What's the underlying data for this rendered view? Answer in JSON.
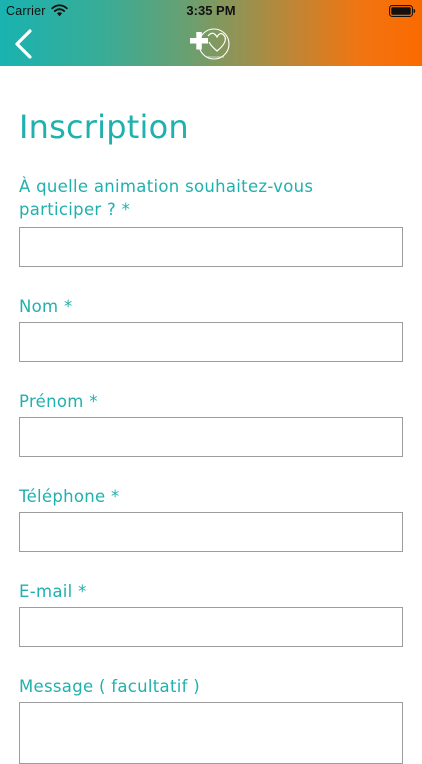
{
  "status_bar": {
    "carrier": "Carrier",
    "time": "3:35 PM"
  },
  "header": {
    "back_icon": "chevron-left-icon",
    "logo_icon": "cross-heart-logo",
    "gradient_start": "#19b3b0",
    "gradient_end": "#fb6a00"
  },
  "colors": {
    "accent": "#1fb1ae",
    "input_border": "#9d9d9d"
  },
  "form": {
    "title": "Inscription",
    "fields": [
      {
        "label": "À quelle animation souhaitez-vous participer ? *",
        "value": "",
        "placeholder": ""
      },
      {
        "label": "Nom *",
        "value": "",
        "placeholder": ""
      },
      {
        "label": "Prénom *",
        "value": "",
        "placeholder": ""
      },
      {
        "label": "Téléphone *",
        "value": "",
        "placeholder": ""
      },
      {
        "label": "E-mail *",
        "value": "",
        "placeholder": ""
      },
      {
        "label": "Message ( facultatif )",
        "value": "",
        "placeholder": ""
      }
    ]
  }
}
